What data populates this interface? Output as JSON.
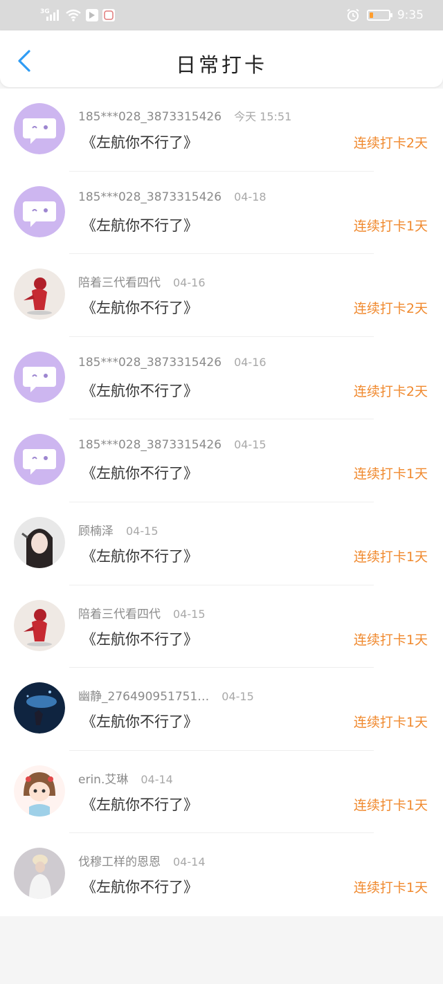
{
  "status_bar": {
    "network": "3G",
    "time": "9:35",
    "battery_fill": 0.18,
    "colors": {
      "battery": "#ff9d2e"
    }
  },
  "navbar": {
    "back_icon": "chevron-left-icon",
    "title": "日常打卡",
    "colors": {
      "back": "#2f9cf4"
    }
  },
  "checkins": [
    {
      "avatar": "purple-chat-bubble",
      "user": "185***028_3873315426",
      "date": "今天 15:51",
      "task": "《左航你不行了》",
      "streak": "连续打卡2天"
    },
    {
      "avatar": "purple-chat-bubble",
      "user": "185***028_3873315426",
      "date": "04-18",
      "task": "《左航你不行了》",
      "streak": "连续打卡1天"
    },
    {
      "avatar": "red-cartoon-figure",
      "user": "陪着三代看四代",
      "date": "04-16",
      "task": "《左航你不行了》",
      "streak": "连续打卡2天"
    },
    {
      "avatar": "purple-chat-bubble",
      "user": "185***028_3873315426",
      "date": "04-16",
      "task": "《左航你不行了》",
      "streak": "连续打卡2天"
    },
    {
      "avatar": "purple-chat-bubble",
      "user": "185***028_3873315426",
      "date": "04-15",
      "task": "《左航你不行了》",
      "streak": "连续打卡1天"
    },
    {
      "avatar": "girl-selfie-photo",
      "user": "顾楠泽",
      "date": "04-15",
      "task": "《左航你不行了》",
      "streak": "连续打卡1天"
    },
    {
      "avatar": "red-cartoon-figure",
      "user": "陪着三代看四代",
      "date": "04-15",
      "task": "《左航你不行了》",
      "streak": "连续打卡1天"
    },
    {
      "avatar": "blue-whale-art",
      "user": "幽静_276490951751…",
      "date": "04-15",
      "task": "《左航你不行了》",
      "streak": "连续打卡1天"
    },
    {
      "avatar": "cartoon-girl-drawing",
      "user": "erin.艾琳",
      "date": "04-14",
      "task": "《左航你不行了》",
      "streak": "连续打卡1天"
    },
    {
      "avatar": "person-white-outfit-photo",
      "user": "伐穆工样的恩恩",
      "date": "04-14",
      "task": "《左航你不行了》",
      "streak": "连续打卡1天"
    }
  ],
  "colors": {
    "accent_orange": "#f0892e",
    "username_gray": "#8a8a8a",
    "avatar_purple": "#cdb6f0"
  }
}
